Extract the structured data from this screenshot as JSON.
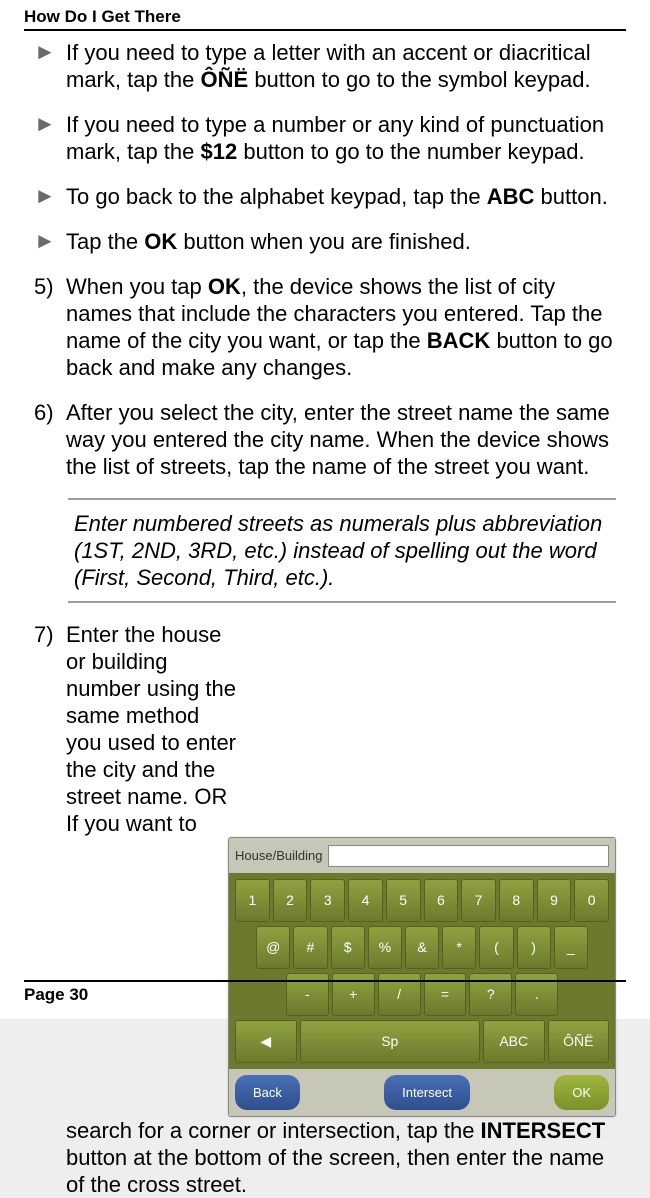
{
  "header": {
    "title": "How Do I Get There"
  },
  "bullets": [
    {
      "pre": "If you need to type a letter with an accent or diacritical mark, tap the ",
      "bold": "ÔÑË",
      "post": " button to go to the symbol keypad."
    },
    {
      "pre": "If you need to type a number or any kind of punctuation mark, tap the ",
      "bold": "$12",
      "post": " button to go to the number keypad."
    },
    {
      "pre": "To go back to the alphabet keypad, tap the ",
      "bold": "ABC",
      "post": " button."
    },
    {
      "pre": "Tap the ",
      "bold": "OK",
      "post": " button when you are finished."
    }
  ],
  "step5": {
    "num": "5)",
    "a": "When you tap ",
    "b1": "OK",
    "c": ", the device shows the list of city names that include the characters you entered. Tap the name of the city you want, or tap the ",
    "b2": "BACK",
    "d": " button to go back and make any changes."
  },
  "step6": {
    "num": "6)",
    "text": "After you select the city, enter the street name the same way you entered the city name. When the device shows the list of streets, tap the name of the street you want."
  },
  "note": "Enter numbered streets as numerals plus abbreviation (1ST, 2ND, 3RD, etc.) instead of spelling out the word (First, Second, Third, etc.).",
  "step7": {
    "num": "7)",
    "top": "Enter the house or building number using the same method you used to enter the city and the street name. OR",
    "mid": "If you want to",
    "a": "search for a corner or intersection, tap the ",
    "b1": "INTERSECT",
    "c": " button at the bottom of the screen, then enter the name of the cross street."
  },
  "keypad": {
    "field_label": "House/Building",
    "row1": [
      "1",
      "2",
      "3",
      "4",
      "5",
      "6",
      "7",
      "8",
      "9",
      "0"
    ],
    "row2": [
      "@",
      "#",
      "$",
      "%",
      "&",
      "*",
      "(",
      ")",
      "_"
    ],
    "row3": [
      "-",
      "+",
      "/",
      "=",
      "?",
      "."
    ],
    "sp": "Sp",
    "abc": "ABC",
    "one": "ÔÑË",
    "left": "◀",
    "back": "Back",
    "intersect": "Intersect",
    "ok": "OK"
  },
  "footer": {
    "page": "Page 30"
  }
}
